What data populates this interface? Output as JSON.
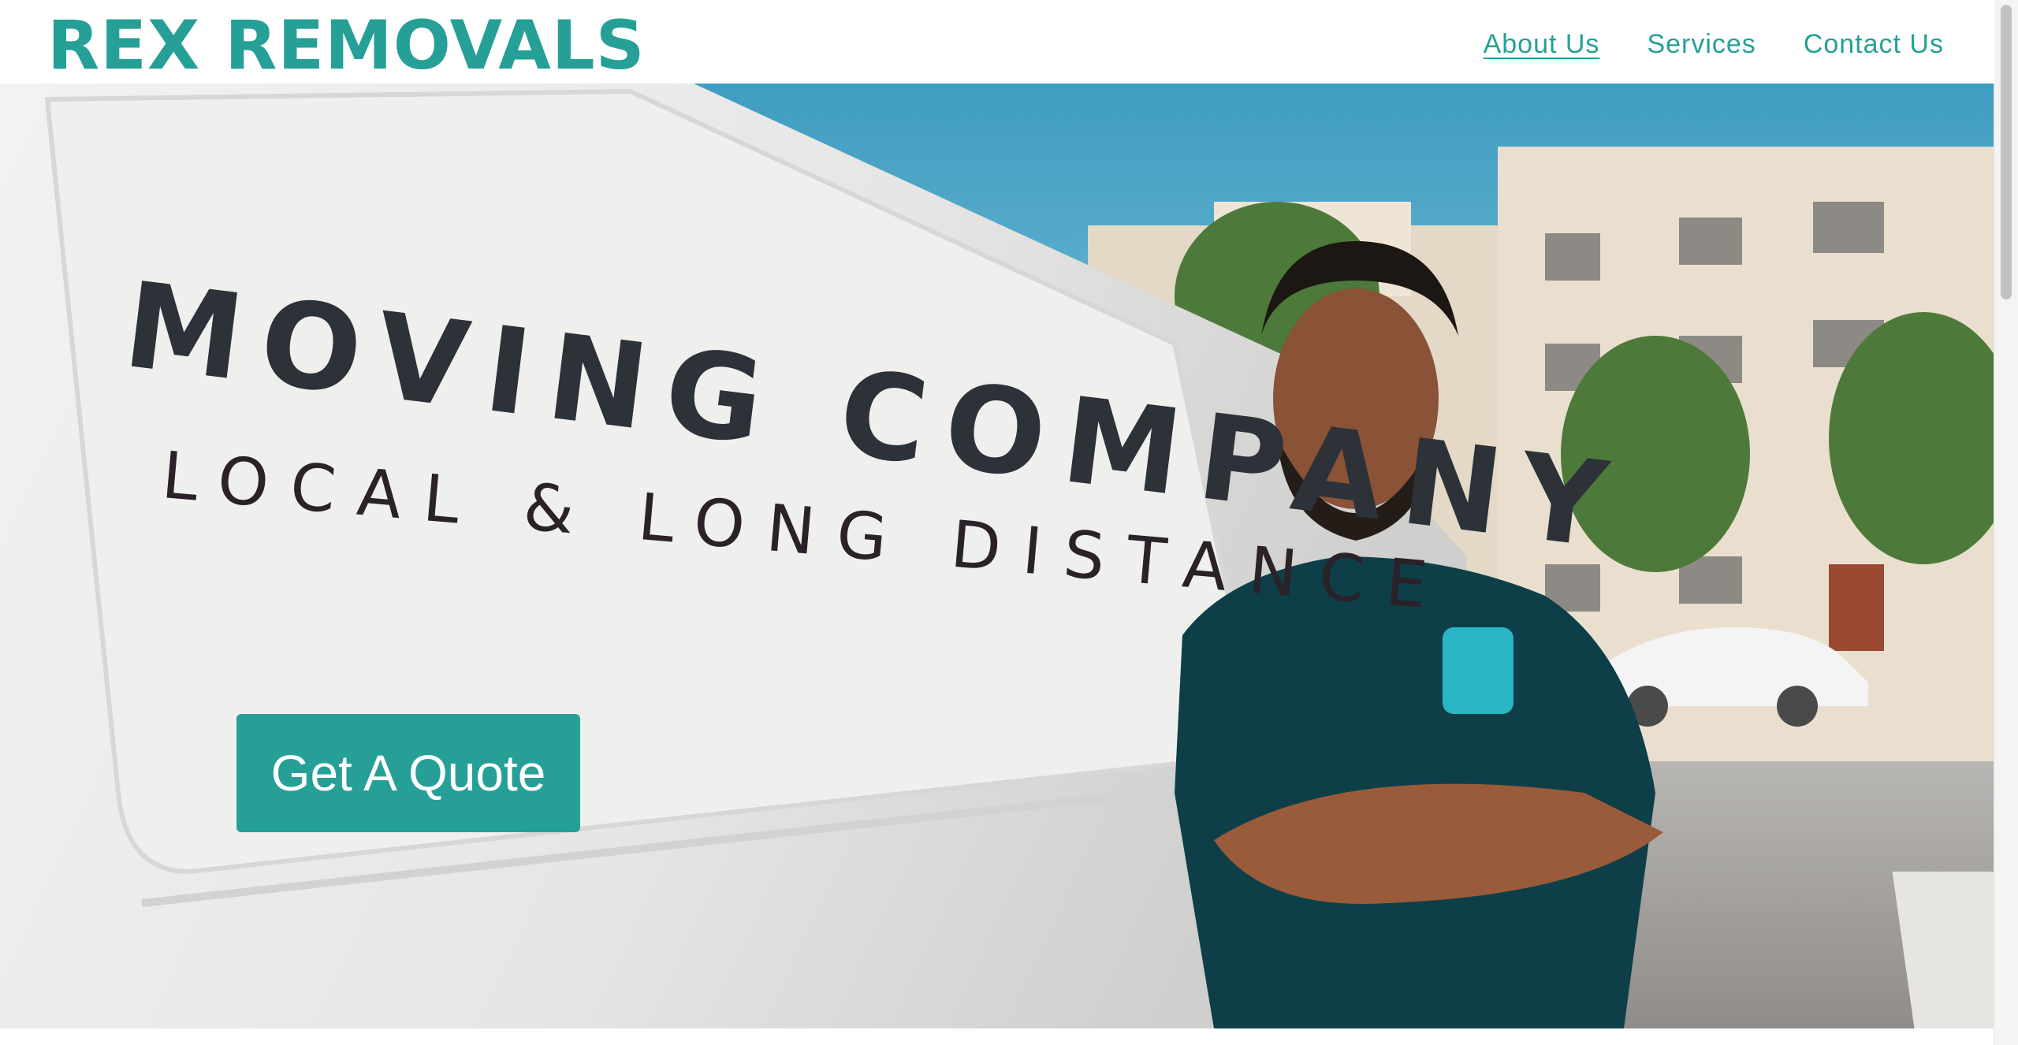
{
  "header": {
    "logo": "REX REMOVALS",
    "nav": [
      {
        "label": "About Us",
        "active": true
      },
      {
        "label": "Services",
        "active": false
      },
      {
        "label": "Contact Us",
        "active": false
      }
    ]
  },
  "hero": {
    "van_text_line1": "MOVING COMPANY",
    "van_text_line2": "LOCAL & LONG DISTANCE",
    "cta_label": "Get A Quote"
  },
  "colors": {
    "brand": "#26a097",
    "text_on_brand": "#ffffff",
    "sky": "#4aa3c4",
    "van": "#ecebea"
  }
}
